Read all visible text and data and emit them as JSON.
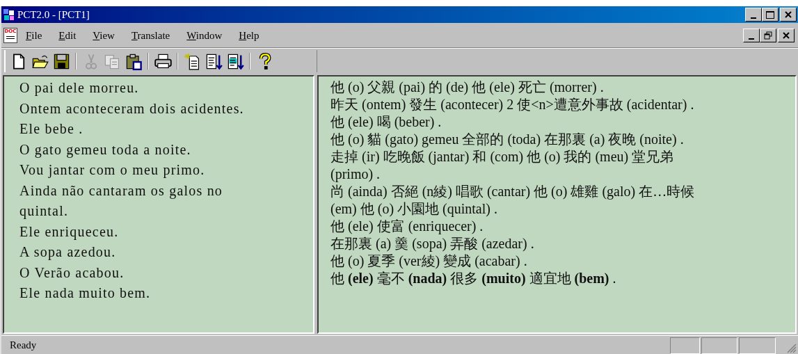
{
  "window": {
    "title": "PCT2.0 - [PCT1]"
  },
  "menu_bar": {
    "doc_icon_label": "DOC",
    "items": [
      "File",
      "Edit",
      "View",
      "Translate",
      "Window",
      "Help"
    ]
  },
  "toolbar": [
    {
      "kind": "new",
      "disabled": false
    },
    {
      "kind": "open",
      "disabled": false
    },
    {
      "kind": "save",
      "disabled": false
    },
    {
      "kind": "separator"
    },
    {
      "kind": "cut",
      "disabled": true
    },
    {
      "kind": "copy",
      "disabled": true
    },
    {
      "kind": "paste",
      "disabled": false
    },
    {
      "kind": "separator"
    },
    {
      "kind": "print",
      "disabled": false
    },
    {
      "kind": "separator"
    },
    {
      "kind": "new-doc",
      "disabled": false
    },
    {
      "kind": "sort",
      "disabled": false
    },
    {
      "kind": "sort-highlight",
      "disabled": false
    },
    {
      "kind": "separator"
    },
    {
      "kind": "help",
      "disabled": false
    }
  ],
  "source_pane": {
    "lines": [
      "O pai dele morreu.",
      "Ontem aconteceram dois acidentes.",
      "Ele bebe .",
      "O gato gemeu toda a noite.",
      "Vou jantar com o meu primo.",
      "Ainda não cantaram os galos no quintal.",
      "Ele enriqueceu.",
      "A sopa azedou.",
      "O Verão acabou.",
      "Ele nada muito bem."
    ]
  },
  "translation_pane": {
    "lines": [
      "他 (o) 父親 (pai) 的 (de) 他 (ele) 死亡 (morrer) .",
      "昨天 (ontem) 發生 (acontecer) 2 使<n>遭意外事故 (acidentar) .",
      "他 (ele) 喝 (beber) .",
      "他 (o) 貓 (gato) gemeu 全部的 (toda) 在那裏 (a) 夜晚 (noite) .",
      "走掉 (ir) 吃晚飯 (jantar) 和 (com) 他 (o) 我的 (meu) 堂兄弟 (primo) .",
      "尚 (ainda) 否絕 (n綾) 唱歌 (cantar) 他 (o) 雄雞 (galo) 在…時候 (em) 他 (o) 小園地 (quintal) .",
      "他 (ele) 使富 (enriquecer) .",
      "在那裏 (a) 羹 (sopa) 弄酸 (azedar) .",
      "他 (o) 夏季 (ver綾) 變成 (acabar) .",
      "他 **(ele)** 毫不 **(nada)** 很多 **(muito)** 適宜地 **(bem)** ."
    ]
  },
  "status_bar": {
    "text": "Ready"
  }
}
